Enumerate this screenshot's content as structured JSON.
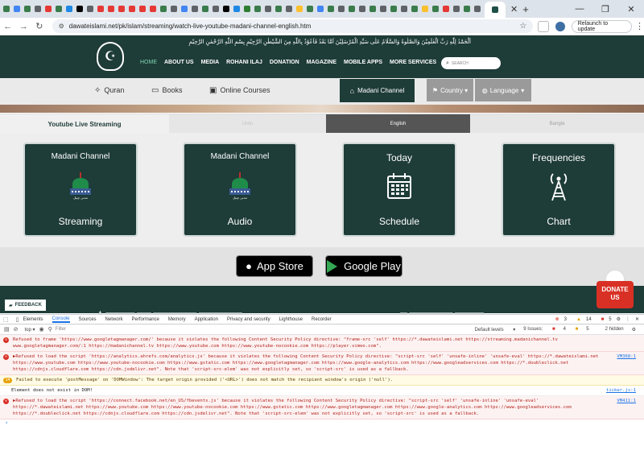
{
  "browser": {
    "url": "dawateislami.net/pk/islam/streaming/watch-live-youtube-madani-channel-english.htm",
    "relaunch_label": "Relaunch to update"
  },
  "site": {
    "arabic_header": "اَلْحَمْدُ لِلّٰهِ رَبِّ الْعٰلَمِیْنَ وَالصَّلٰوةُ وَالسَّلَامُ عَلٰی سَیِّدِ الْمُرْسَلِیْنَ اَمَّا بَعْدُ فَاَعُوْذُ بِاللّٰهِ مِنَ الشَّیْطٰنِ الرَّجِیْمِ بِسْمِ اللّٰهِ الرَّحْمٰنِ الرَّحِیْمِ",
    "nav": [
      "HOME",
      "ABOUT US",
      "MEDIA",
      "ROHANI ILAJ",
      "DONATION",
      "MAGAZINE",
      "MOBILE APPS",
      "MORE SERVICES"
    ],
    "search_placeholder": "SEARCH"
  },
  "subnav": {
    "quran": "Quran",
    "books": "Books",
    "courses": "Online Courses",
    "madani": "Madani Channel",
    "country": "Country",
    "language": "Language"
  },
  "lang_tabs": {
    "title": "Youtube Live Streaming",
    "urdu": "Urdu",
    "english": "English",
    "bangla": "Bangla",
    "active": "English"
  },
  "cards": [
    {
      "line1": "Madani Channel",
      "line2": "Streaming",
      "icon": "madani-channel-logo-icon"
    },
    {
      "line1": "Madani Channel",
      "line2": "Audio",
      "icon": "madani-channel-logo-icon"
    },
    {
      "line1": "Today",
      "line2": "Schedule",
      "icon": "calendar-icon"
    },
    {
      "line1": "Frequencies",
      "line2": "Chart",
      "icon": "antenna-tower-icon"
    }
  ],
  "logo_caption": "مدنی چینل",
  "stores": {
    "apple": "App Store",
    "google": "Google Play"
  },
  "footer": {
    "feedback": "FEEDBACK",
    "donate_line1": "DONATE",
    "donate_line2": "US"
  },
  "devtools": {
    "tabs": [
      "Elements",
      "Console",
      "Sources",
      "Network",
      "Performance",
      "Memory",
      "Application",
      "Privacy and security",
      "Lighthouse",
      "Recorder"
    ],
    "active_tab": "Console",
    "error_count": "3",
    "warning_count": "14",
    "issue_count_badge": "5",
    "context": "top",
    "filter_placeholder": "Filter",
    "levels": "Default levels",
    "issues": "9 Issues:",
    "issues_errors": "4",
    "issues_warnings": "5",
    "hidden": "2 hidden",
    "messages": [
      {
        "level": "error",
        "text": "Refused to frame 'https://www.googletagmanager.com/' because it violates the following Content Security Policy directive: \"frame-src 'self' https://*.dawateislami.net https://streaming.madanichannel.tv www.googletagmanager.com/:1 https://madanichannel.tv https://www.youtube.com https://www.youtube-nocookie.com https://player.vimeo.com\".",
        "source": ""
      },
      {
        "level": "error",
        "text": "▶Refused to load the script 'https://analytics.ahrefs.com/analytics.js' because it violates the following Content Security Policy directive: \"script-src 'self' 'unsafe-inline' 'unsafe-eval' https://*.dawateislami.net https://www.youtube.com https://www.youtube-nocookie.com https://www.gstatic.com https://www.googletagmanager.com https://www.google-analytics.com https://www.googleadservices.com https://*.doubleclick.net https://cdnjs.cloudflare.com https://cdn.jsdelivr.net\". Note that 'script-src-elem' was not explicitly set, so 'script-src' is used as a fallback.",
        "source": "VM368:1"
      },
      {
        "level": "warning",
        "count": "14",
        "text": "Failed to execute 'postMessage' on 'DOMWindow': The target origin provided ('<URL>') does not match the recipient window's origin ('null').",
        "source": ""
      },
      {
        "level": "plain",
        "text": "Element does not exist in DOM!",
        "source": "ticker.js:1"
      },
      {
        "level": "error",
        "text": "▶Refused to load the script 'https://connect.facebook.net/en_US/fbevents.js' because it violates the following Content Security Policy directive: \"script-src 'self' 'unsafe-inline' 'unsafe-eval' https://*.dawateislami.net https://www.youtube.com https://www.youtube-nocookie.com https://www.gstatic.com https://www.googletagmanager.com https://www.google-analytics.com https://www.googleadservices.com https://*.doubleclick.net https://cdnjs.cloudflare.com https://cdn.jsdelivr.net\". Note that 'script-src-elem' was not explicitly set, so 'script-src' is used as a fallback.",
        "source": "VM411:1"
      }
    ]
  },
  "colors": {
    "brand_green": "#1e3c38",
    "active_lang_tab": "#555555",
    "inactive_lang_tab": "#e6e6e6",
    "dropdown_gray": "#9a9a9a",
    "donate_red": "#d93025"
  }
}
